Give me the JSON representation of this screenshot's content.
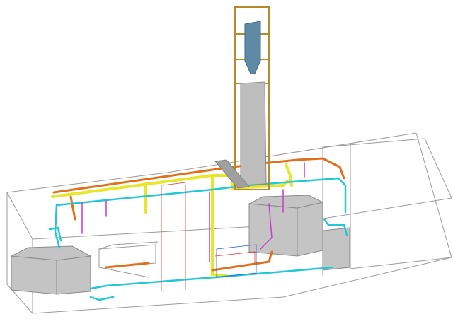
{
  "colors": {
    "background": "#ffffff",
    "frame": "#9a9a9a",
    "equipment_fill": "#c4c4c4",
    "equipment_edge": "#8a8a8a",
    "yellow_pipe": "#e8e62a",
    "orange_pipe": "#e0701e",
    "cyan_pipe": "#23c7d6",
    "magenta_pipe": "#c83cc8",
    "red_line": "#e2343a",
    "blue_line": "#2f5fd0",
    "tower_frame": "#b58a2c",
    "tower_body": "#bdbdbd",
    "cyclone": "#5f8aa6"
  },
  "scene": {
    "view": "isometric-3d-piping-model",
    "items": [
      "building-enclosure",
      "support-tower",
      "cyclone-vessel",
      "left-tank",
      "right-tank",
      "center-skid",
      "piping-network"
    ]
  }
}
